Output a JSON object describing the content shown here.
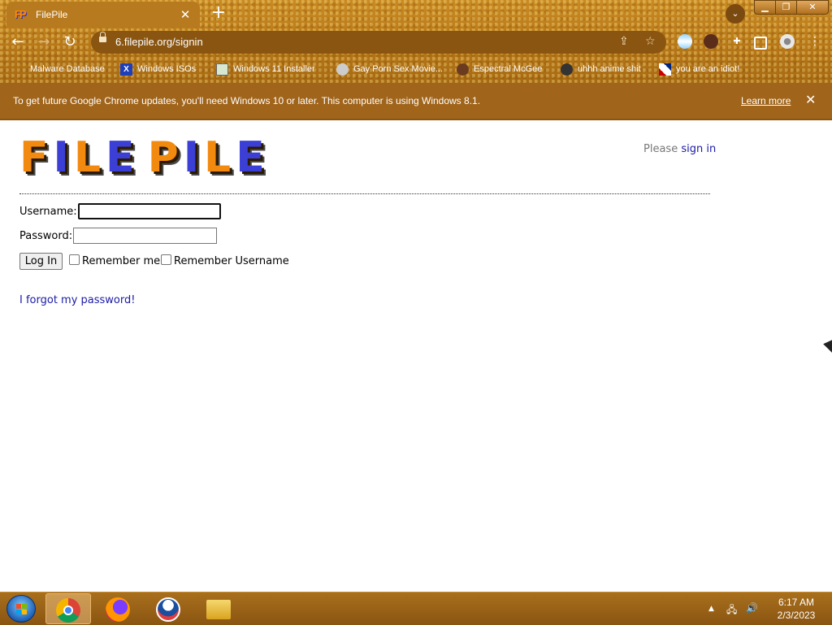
{
  "browser": {
    "tab": {
      "favicon_text": "FP",
      "title": "FilePile",
      "close_symbol": "✕"
    },
    "new_tab_symbol": "+",
    "window_controls": {
      "minimize": "▁",
      "maximize": "❐",
      "close": "✕"
    },
    "url": "6.filepile.org/signin",
    "bookmarks": [
      {
        "label": "Malware Database",
        "icon": "blank-folder-icon"
      },
      {
        "label": "Windows ISOs",
        "icon": "x-icon"
      },
      {
        "label": "Windows 11 Installer",
        "icon": "image-icon"
      },
      {
        "label": "Gay Porn Sex Movie...",
        "icon": "disc-icon"
      },
      {
        "label": "Espectral McGee",
        "icon": "avatar-icon"
      },
      {
        "label": "uhhh anime shit",
        "icon": "anime-icon"
      },
      {
        "label": "you are an idiot!",
        "icon": "flag-icon"
      }
    ],
    "infobar": {
      "message": "To get future Google Chrome updates, you'll need Windows 10 or later. This computer is using Windows 8.1.",
      "link": "Learn more",
      "close_symbol": "✕"
    },
    "accent_color": "#b87818"
  },
  "page": {
    "logo_text": [
      "F",
      "I",
      "L",
      "E",
      " ",
      "P",
      "I",
      "L",
      "E"
    ],
    "signin_prompt": "Please",
    "signin_link": "sign in",
    "form": {
      "username_label": "Username:",
      "username_value": "",
      "password_label": "Password:",
      "password_value": "",
      "login_button": "Log In",
      "remember_me": "Remember me",
      "remember_username": "Remember Username"
    },
    "forgot_link": "I forgot my password!"
  },
  "taskbar": {
    "pinned": [
      "start-orb",
      "chrome",
      "firefox",
      "obama-app",
      "file-explorer"
    ],
    "time": "6:17 AM",
    "date": "2/3/2023"
  }
}
